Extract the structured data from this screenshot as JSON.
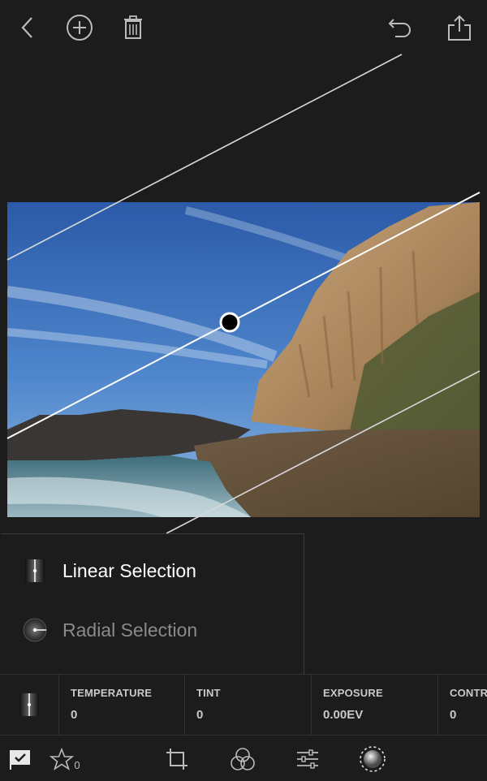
{
  "toolbar": {
    "icons": [
      "back-chevron-icon",
      "add-icon",
      "trash-icon",
      "undo-icon",
      "share-icon"
    ]
  },
  "selection_menu": {
    "linear_label": "Linear Selection",
    "radial_label": "Radial Selection"
  },
  "adjustments": [
    {
      "label": "TEMPERATURE",
      "value": "0"
    },
    {
      "label": "TINT",
      "value": "0"
    },
    {
      "label": "EXPOSURE",
      "value": "0.00EV"
    },
    {
      "label": "CONTRAST",
      "value": "0"
    }
  ],
  "bottom_toolbar": {
    "rating_count": "0"
  },
  "colors": {
    "background": "#1c1c1c",
    "active_text": "#ffffff",
    "inactive_text": "#8a8a8a"
  }
}
